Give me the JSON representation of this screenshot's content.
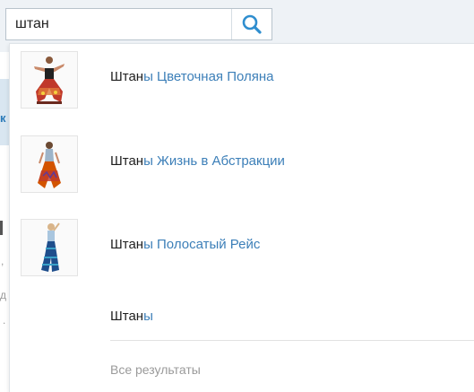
{
  "search": {
    "value": "штан",
    "button_icon": "search-icon"
  },
  "background": {
    "fragments": [
      "к",
      ",",
      "д",
      "."
    ]
  },
  "suggestions": [
    {
      "match": "Штан",
      "rest": "ы Цветочная Поляна",
      "thumb": "pants-photo"
    },
    {
      "match": "Штан",
      "rest": "ы Жизнь в Абстракции",
      "thumb": "pants-photo"
    },
    {
      "match": "Штан",
      "rest": "ы Полосатый Рейс",
      "thumb": "pants-photo"
    },
    {
      "match": "Штан",
      "rest": "ы"
    }
  ],
  "all_results_label": "Все результаты",
  "colors": {
    "link": "#3c7fb8",
    "match_text": "#1f1f1f",
    "accent_icon": "#2f8ecf",
    "muted": "#9a9a9a"
  }
}
